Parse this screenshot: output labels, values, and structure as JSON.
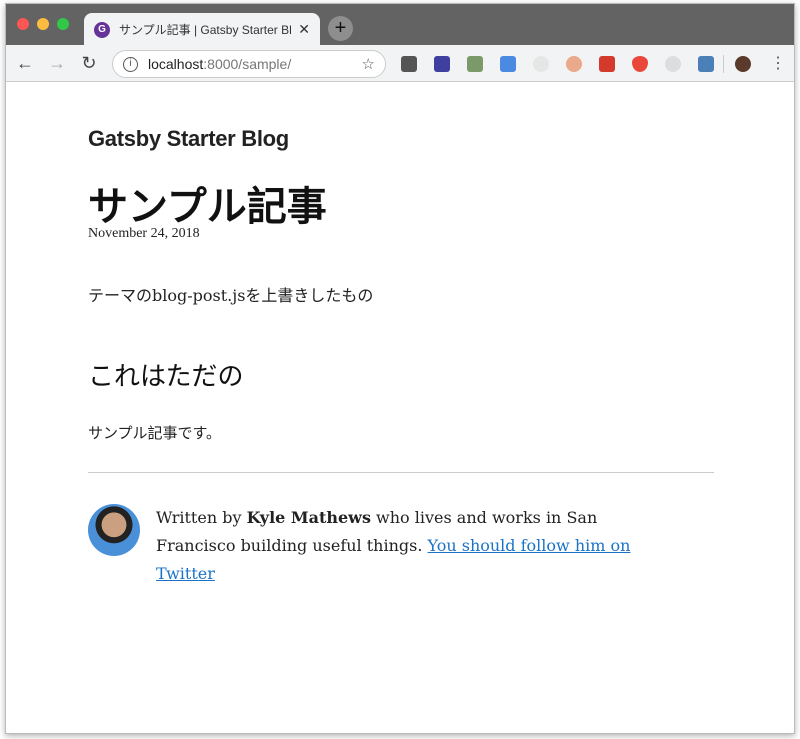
{
  "browser": {
    "tab_title": "サンプル記事 | Gatsby Starter Blog",
    "favicon": "gatsby-icon",
    "url_host": "localhost",
    "url_path": ":8000/sample/",
    "extensions": [
      "pocket",
      "zotero",
      "chart",
      "google-translate",
      "circle",
      "screenshot",
      "adobe",
      "shield",
      "sync",
      "ext-image"
    ],
    "colors": {
      "titlebar": "#636363",
      "toolbar": "#f1f3f4",
      "link": "#1a73c8"
    }
  },
  "page": {
    "blog_title": "Gatsby Starter Blog",
    "post_title": "サンプル記事",
    "date": "November 24, 2018",
    "paragraph1": "テーマのblog-post.jsを上書きしたもの",
    "heading2": "これはただの",
    "paragraph2": "サンプル記事です。",
    "bio": {
      "prefix": "Written by ",
      "author": "Kyle Mathews",
      "suffix": " who lives and works in San Francisco building useful things. ",
      "link": "You should follow him on Twitter"
    }
  }
}
